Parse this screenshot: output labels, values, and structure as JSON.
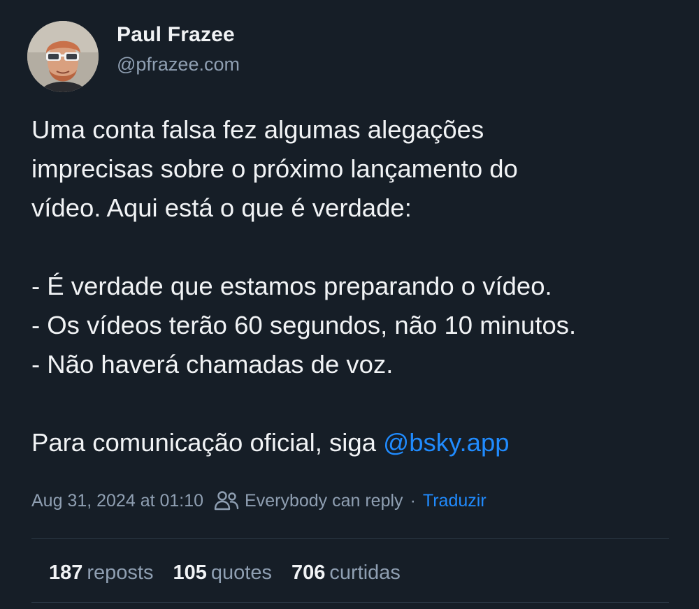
{
  "author": {
    "name": "Paul Frazee",
    "handle": "@pfrazee.com"
  },
  "post": {
    "lines": [
      "Uma conta falsa fez algumas alegações",
      "imprecisas sobre o próximo lançamento do",
      "vídeo. Aqui está o que é verdade:",
      "- É verdade que estamos preparando o vídeo.",
      "- Os vídeos terão 60 segundos, não 10 minutos.",
      "- Não haverá chamadas de voz.",
      "Para comunicação oficial, siga "
    ],
    "mention": "@bsky.app"
  },
  "meta": {
    "timestamp": "Aug 31, 2024 at 01:10",
    "reply_setting": "Everybody can reply",
    "separator": "·",
    "translate_label": "Traduzir"
  },
  "stats": [
    {
      "count": "187",
      "label": "reposts"
    },
    {
      "count": "105",
      "label": "quotes"
    },
    {
      "count": "706",
      "label": "curtidas"
    }
  ],
  "colors": {
    "background": "#161e27",
    "text": "#f1f3f5",
    "muted": "#8f9fb2",
    "link": "#208bfe",
    "divider": "#2e3a48"
  },
  "icons": {
    "reply_setting": "people-icon"
  }
}
